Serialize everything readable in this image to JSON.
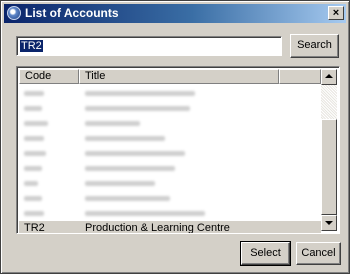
{
  "window": {
    "title": "List of Accounts",
    "close_glyph": "×"
  },
  "search": {
    "value": "TR2",
    "button_label": "Search"
  },
  "list": {
    "columns": {
      "code": "Code",
      "title": "Title"
    },
    "blurred_rows": 9,
    "selected_row": {
      "code": "TR2",
      "title": "Production & Learning Centre"
    }
  },
  "buttons": {
    "select": "Select",
    "cancel": "Cancel"
  },
  "icons": {
    "app": "app-logo-icon",
    "close": "close-icon",
    "scroll_up": "arrow-up-icon",
    "scroll_down": "arrow-down-icon"
  }
}
